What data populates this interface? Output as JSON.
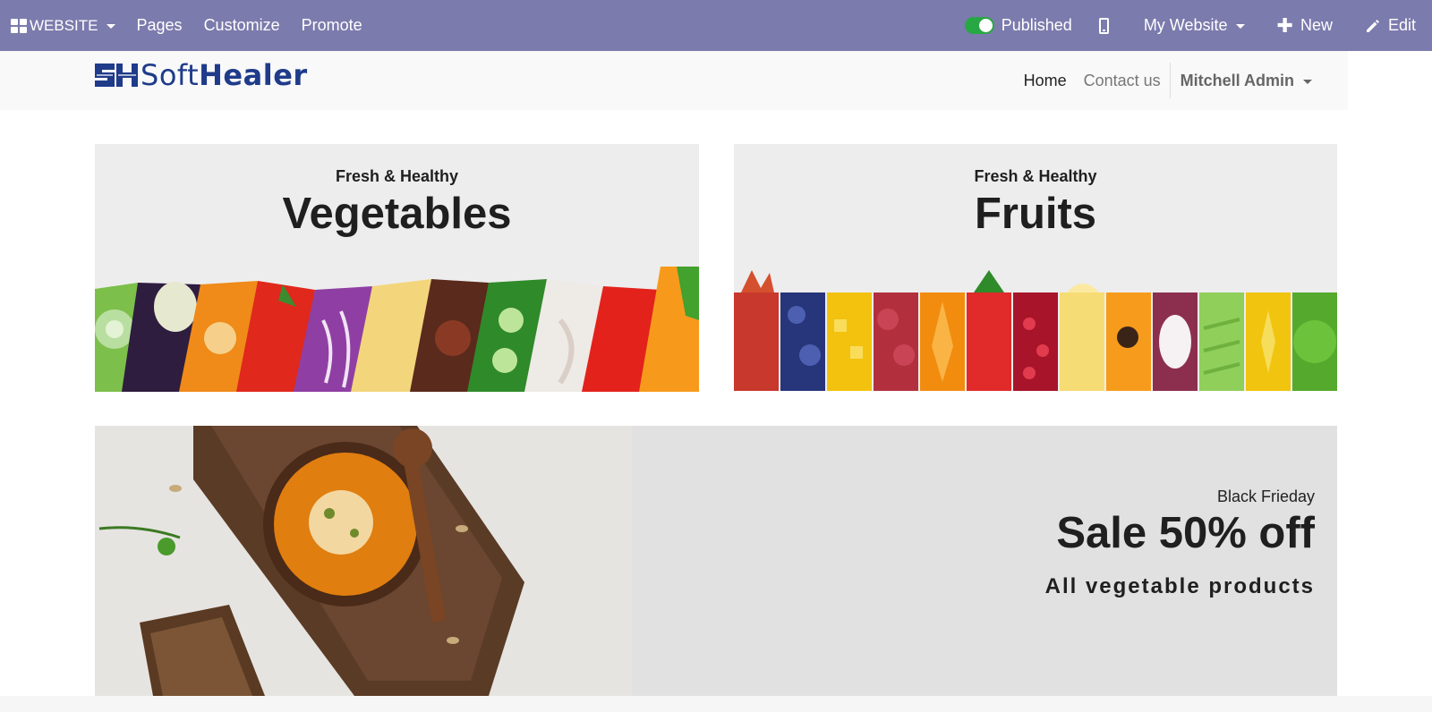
{
  "admin_bar": {
    "app_label": "WEBSITE",
    "menu": [
      "Pages",
      "Customize",
      "Promote"
    ],
    "published_label": "Published",
    "published": true,
    "site_selector": "My Website",
    "new_label": "New",
    "edit_label": "Edit",
    "background_color": "#7c7bad"
  },
  "site_header": {
    "logo_text_part1": "Soft",
    "logo_text_part2": "Healer",
    "nav": {
      "home": "Home",
      "contact": "Contact us",
      "user": "Mitchell Admin"
    }
  },
  "banners": {
    "vegetables": {
      "subtitle": "Fresh & Healthy",
      "title": "Vegetables"
    },
    "fruits": {
      "subtitle": "Fresh & Healthy",
      "title": "Fruits"
    },
    "sale": {
      "subtitle": "Black Frieday",
      "title": "Sale 50% off",
      "description": "All vegetable products"
    }
  },
  "icons": {
    "apps": "apps-grid-icon",
    "toggle": "toggle-on-icon",
    "mobile": "mobile-phone-icon",
    "new": "plus-icon",
    "edit": "pencil-icon"
  },
  "colors": {
    "brand_blue": "#1f3b8a",
    "publish_green": "#28a745"
  }
}
